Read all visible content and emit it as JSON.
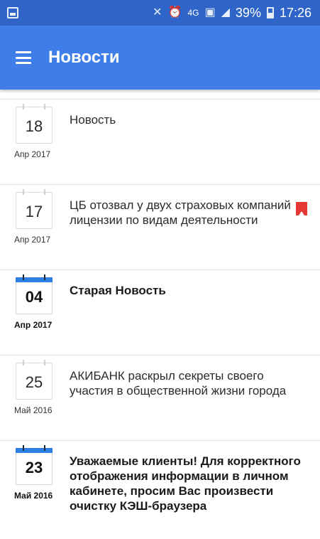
{
  "status_bar": {
    "battery": "39%",
    "time": "17:26",
    "network": "4G"
  },
  "app_bar": {
    "title": "Новости",
    "menu_icon": "menu-icon"
  },
  "news": [
    {
      "day": "18",
      "month_year": "Апр 2017",
      "title": "Новость",
      "bold": false,
      "bookmarked": false
    },
    {
      "day": "17",
      "month_year": "Апр 2017",
      "title": "ЦБ отозвал у двух страховых компаний лицензии по видам деятельности",
      "bold": false,
      "bookmarked": true
    },
    {
      "day": "04",
      "month_year": "Апр 2017",
      "title": "Старая Новость",
      "bold": true,
      "bookmarked": false
    },
    {
      "day": "25",
      "month_year": "Май 2016",
      "title": "АКИБАНК раскрыл секреты своего участия в общественной жизни города",
      "bold": false,
      "bookmarked": false
    },
    {
      "day": "23",
      "month_year": "Май 2016",
      "title": "Уважаемые клиенты! Для корректного отображения информации в личном кабинете, просим Вас произвести очистку КЭШ-браузера",
      "bold": true,
      "bookmarked": false
    }
  ],
  "colors": {
    "status_bar": "#2f65c8",
    "app_bar": "#3f7ee8",
    "calendar_accent": "#2d7fe3",
    "bookmark": "#e53935"
  }
}
